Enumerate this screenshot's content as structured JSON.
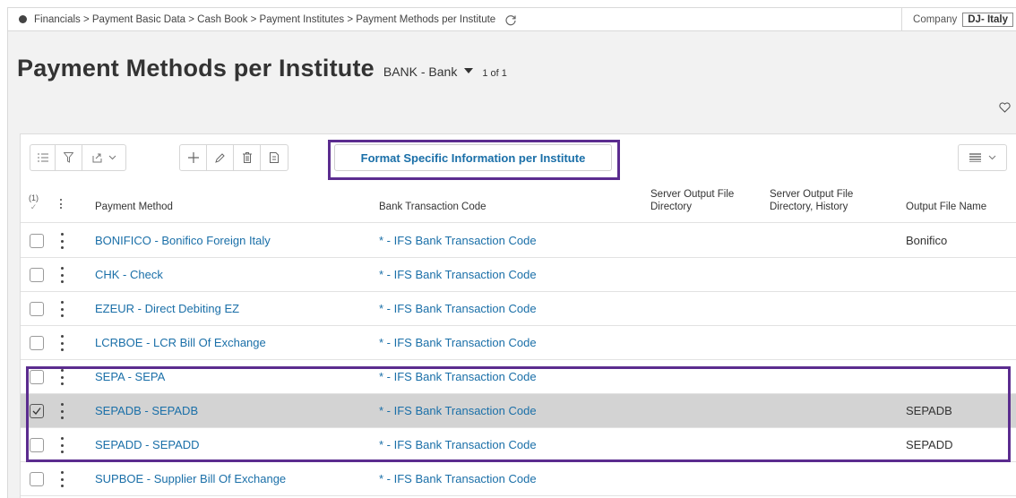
{
  "breadcrumb": "Financials > Payment Basic Data > Cash Book > Payment Institutes > Payment Methods per Institute",
  "company": {
    "label": "Company",
    "value": "DJ- Italy"
  },
  "page": {
    "title": "Payment Methods per Institute",
    "context": "BANK - Bank",
    "counter": "1 of 1"
  },
  "toolbar": {
    "format_button": "Format Specific Information per Institute"
  },
  "grid": {
    "selection_count": "(1)",
    "columns": {
      "payment_method": "Payment Method",
      "bank_transaction_code": "Bank Transaction Code",
      "server_output_dir": "Server Output File Directory",
      "server_output_dir_history": "Server Output File Directory, History",
      "output_file_name": "Output File Name"
    },
    "rows": [
      {
        "payment_method": "BONIFICO - Bonifico Foreign Italy",
        "bank_transaction_code": "* - IFS Bank Transaction Code",
        "output_file_name": "Bonifico",
        "selected": false
      },
      {
        "payment_method": "CHK - Check",
        "bank_transaction_code": "* - IFS Bank Transaction Code",
        "output_file_name": "",
        "selected": false
      },
      {
        "payment_method": "EZEUR - Direct Debiting EZ",
        "bank_transaction_code": "* - IFS Bank Transaction Code",
        "output_file_name": "",
        "selected": false
      },
      {
        "payment_method": "LCRBOE - LCR Bill Of Exchange",
        "bank_transaction_code": "* - IFS Bank Transaction Code",
        "output_file_name": "",
        "selected": false
      },
      {
        "payment_method": "SEPA - SEPA",
        "bank_transaction_code": "* - IFS Bank Transaction Code",
        "output_file_name": "",
        "selected": false
      },
      {
        "payment_method": "SEPADB - SEPADB",
        "bank_transaction_code": "* - IFS Bank Transaction Code",
        "output_file_name": "SEPADB",
        "selected": true
      },
      {
        "payment_method": "SEPADD - SEPADD",
        "bank_transaction_code": "* - IFS Bank Transaction Code",
        "output_file_name": "SEPADD",
        "selected": false
      },
      {
        "payment_method": "SUPBOE - Supplier Bill Of Exchange",
        "bank_transaction_code": "* - IFS Bank Transaction Code",
        "output_file_name": "",
        "selected": false
      }
    ]
  },
  "colors": {
    "link": "#1a6fa8",
    "highlight": "#5b2c8f",
    "selected_row": "#d3d3d3"
  }
}
